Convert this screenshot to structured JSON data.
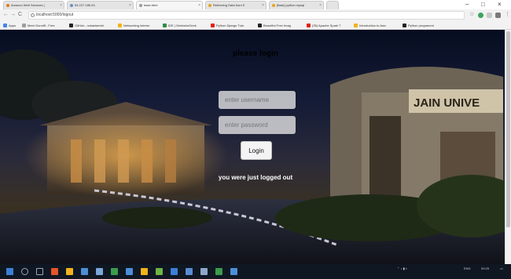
{
  "browser": {
    "tabs": [
      {
        "label": "Amazon Web Services (",
        "active": false,
        "favicon_color": "#e07b1a"
      },
      {
        "label": "54.227.185.43",
        "active": false,
        "favicon_color": "#6b8fc7"
      },
      {
        "label": "base.html",
        "active": true,
        "favicon_color": "#9a9a9a"
      },
      {
        "label": "Retrieving Data from fl",
        "active": false,
        "favicon_color": "#e5a420"
      },
      {
        "label": "[flask] python mysql",
        "active": false,
        "favicon_color": "#e5a420"
      }
    ],
    "window_controls": {
      "minimize": "–",
      "maximize": "□",
      "close": "×"
    },
    "url": "localhost:5000/logout",
    "bookmarks": [
      {
        "label": "Apps",
        "icon_color": "#4285f4"
      },
      {
        "label": "Meet Gunolff - Free",
        "icon_color": "#9e9e9e"
      },
      {
        "label": "GitHub - natashembi",
        "icon_color": "#222222"
      },
      {
        "label": "Networking interne",
        "icon_color": "#f2b21c"
      },
      {
        "label": "IDE | GeeksforGeek",
        "icon_color": "#2f8d46"
      },
      {
        "label": "Python Django Tuto",
        "icon_color": "#e62117"
      },
      {
        "label": "Beautiful Free Imag",
        "icon_color": "#222222"
      },
      {
        "label": "(35) Apache Spark T",
        "icon_color": "#e62117"
      },
      {
        "label": "Introduction to Amc",
        "icon_color": "#f2b21c"
      },
      {
        "label": "Python programmi",
        "icon_color": "#222222"
      }
    ]
  },
  "page": {
    "title": "please login",
    "username_placeholder": "enter username",
    "password_placeholder": "enter password",
    "login_button": "Login",
    "message": "you were just logged out",
    "background_banner_text": "JAIN UNIVE"
  },
  "taskbar": {
    "icons": [
      {
        "name": "start",
        "color": "#3b7fd6"
      },
      {
        "name": "search",
        "color": "#9aa7b8"
      },
      {
        "name": "task-view",
        "color": "#9aa7b8"
      },
      {
        "name": "app1",
        "color": "#e5532b"
      },
      {
        "name": "file-explorer",
        "color": "#f2b21c"
      },
      {
        "name": "app3",
        "color": "#4c8ed6"
      },
      {
        "name": "app4",
        "color": "#7aa6d8"
      },
      {
        "name": "chrome",
        "color": "#3a9b4b"
      },
      {
        "name": "app6",
        "color": "#4c8ed6"
      },
      {
        "name": "app7",
        "color": "#f2b21c"
      },
      {
        "name": "app8",
        "color": "#6fb344"
      },
      {
        "name": "app9",
        "color": "#3b7fd6"
      },
      {
        "name": "app10",
        "color": "#5a8bd0"
      },
      {
        "name": "app11",
        "color": "#8fa7c7"
      },
      {
        "name": "app12",
        "color": "#3a9b4b"
      },
      {
        "name": "app13",
        "color": "#4c8ed6"
      }
    ],
    "language": "ENG",
    "time": "09:25"
  }
}
